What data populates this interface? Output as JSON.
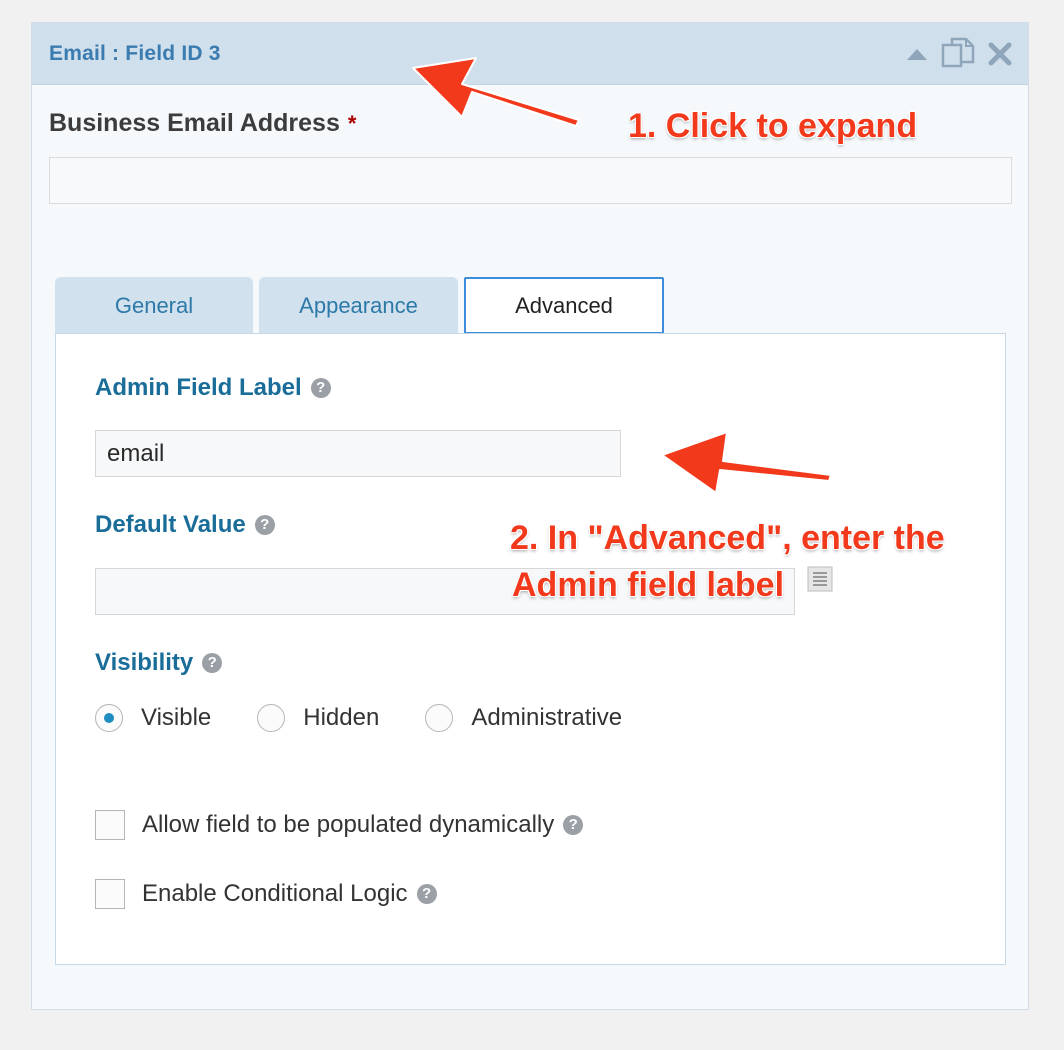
{
  "field_panel": {
    "title": "Email : Field ID 3",
    "icons": [
      "collapse-arrow-icon",
      "duplicate-icon",
      "delete-icon"
    ],
    "field_label": "Business Email Address",
    "required_marker": "*",
    "field_input_value": ""
  },
  "tabs": [
    {
      "label": "General",
      "active": false
    },
    {
      "label": "Appearance",
      "active": false
    },
    {
      "label": "Advanced",
      "active": true
    }
  ],
  "advanced": {
    "admin_label": {
      "title": "Admin Field Label",
      "value": "email",
      "help": "?"
    },
    "default_value": {
      "title": "Default Value",
      "value": "",
      "help": "?"
    },
    "visibility": {
      "title": "Visibility",
      "help": "?",
      "options": [
        {
          "label": "Visible",
          "checked": true
        },
        {
          "label": "Hidden",
          "checked": false
        },
        {
          "label": "Administrative",
          "checked": false
        }
      ]
    },
    "checkboxes": [
      {
        "label": "Allow field to be populated dynamically",
        "checked": false,
        "help": "?"
      },
      {
        "label": "Enable Conditional Logic",
        "checked": false,
        "help": "?"
      }
    ]
  },
  "annotations": {
    "step1": "1. Click to expand",
    "step2_line1": "2. In \"Advanced\", enter the",
    "step2_line2": "Admin field label"
  },
  "colors": {
    "header_bg": "#d0dfec",
    "accent_blue": "#1a6d99",
    "annotation_red": "#f2391c"
  }
}
